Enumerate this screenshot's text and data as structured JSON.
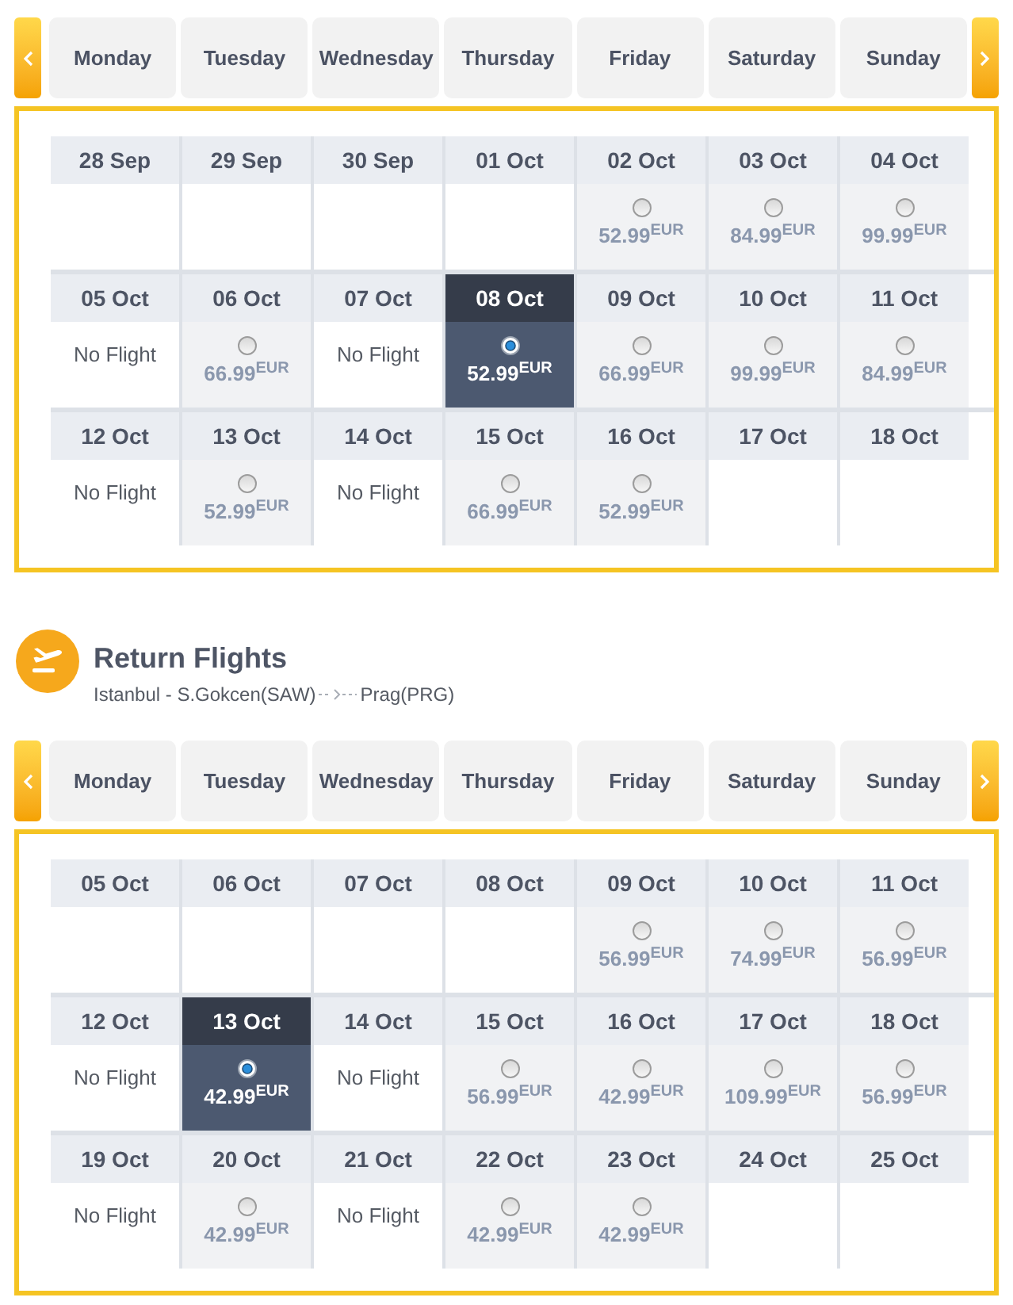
{
  "outbound_calendar": {
    "weekdays": [
      "Monday",
      "Tuesday",
      "Wednesday",
      "Thursday",
      "Friday",
      "Saturday",
      "Sunday"
    ],
    "weeks": [
      [
        {
          "date": "28 Sep",
          "kind": "empty"
        },
        {
          "date": "29 Sep",
          "kind": "empty"
        },
        {
          "date": "30 Sep",
          "kind": "empty"
        },
        {
          "date": "01 Oct",
          "kind": "empty"
        },
        {
          "date": "02 Oct",
          "kind": "fare",
          "price": "52.99",
          "currency": "EUR",
          "selected": false
        },
        {
          "date": "03 Oct",
          "kind": "fare",
          "price": "84.99",
          "currency": "EUR",
          "selected": false
        },
        {
          "date": "04 Oct",
          "kind": "fare",
          "price": "99.99",
          "currency": "EUR",
          "selected": false
        }
      ],
      [
        {
          "date": "05 Oct",
          "kind": "no_flight",
          "text": "No Flight"
        },
        {
          "date": "06 Oct",
          "kind": "fare",
          "price": "66.99",
          "currency": "EUR",
          "selected": false
        },
        {
          "date": "07 Oct",
          "kind": "no_flight",
          "text": "No Flight"
        },
        {
          "date": "08 Oct",
          "kind": "fare",
          "price": "52.99",
          "currency": "EUR",
          "selected": true
        },
        {
          "date": "09 Oct",
          "kind": "fare",
          "price": "66.99",
          "currency": "EUR",
          "selected": false
        },
        {
          "date": "10 Oct",
          "kind": "fare",
          "price": "99.99",
          "currency": "EUR",
          "selected": false
        },
        {
          "date": "11 Oct",
          "kind": "fare",
          "price": "84.99",
          "currency": "EUR",
          "selected": false
        }
      ],
      [
        {
          "date": "12 Oct",
          "kind": "no_flight",
          "text": "No Flight"
        },
        {
          "date": "13 Oct",
          "kind": "fare",
          "price": "52.99",
          "currency": "EUR",
          "selected": false
        },
        {
          "date": "14 Oct",
          "kind": "no_flight",
          "text": "No Flight"
        },
        {
          "date": "15 Oct",
          "kind": "fare",
          "price": "66.99",
          "currency": "EUR",
          "selected": false
        },
        {
          "date": "16 Oct",
          "kind": "fare",
          "price": "52.99",
          "currency": "EUR",
          "selected": false
        },
        {
          "date": "17 Oct",
          "kind": "empty"
        },
        {
          "date": "18 Oct",
          "kind": "empty"
        }
      ]
    ]
  },
  "return_flights": {
    "title": "Return Flights",
    "route": {
      "origin": "Istanbul - S.Gokcen(SAW)",
      "destination": "Prag(PRG)"
    },
    "calendar": {
      "weekdays": [
        "Monday",
        "Tuesday",
        "Wednesday",
        "Thursday",
        "Friday",
        "Saturday",
        "Sunday"
      ],
      "weeks": [
        [
          {
            "date": "05 Oct",
            "kind": "empty"
          },
          {
            "date": "06 Oct",
            "kind": "empty"
          },
          {
            "date": "07 Oct",
            "kind": "empty"
          },
          {
            "date": "08 Oct",
            "kind": "empty"
          },
          {
            "date": "09 Oct",
            "kind": "fare",
            "price": "56.99",
            "currency": "EUR",
            "selected": false
          },
          {
            "date": "10 Oct",
            "kind": "fare",
            "price": "74.99",
            "currency": "EUR",
            "selected": false
          },
          {
            "date": "11 Oct",
            "kind": "fare",
            "price": "56.99",
            "currency": "EUR",
            "selected": false
          }
        ],
        [
          {
            "date": "12 Oct",
            "kind": "no_flight",
            "text": "No Flight"
          },
          {
            "date": "13 Oct",
            "kind": "fare",
            "price": "42.99",
            "currency": "EUR",
            "selected": true
          },
          {
            "date": "14 Oct",
            "kind": "no_flight",
            "text": "No Flight"
          },
          {
            "date": "15 Oct",
            "kind": "fare",
            "price": "56.99",
            "currency": "EUR",
            "selected": false
          },
          {
            "date": "16 Oct",
            "kind": "fare",
            "price": "42.99",
            "currency": "EUR",
            "selected": false
          },
          {
            "date": "17 Oct",
            "kind": "fare",
            "price": "109.99",
            "currency": "EUR",
            "selected": false
          },
          {
            "date": "18 Oct",
            "kind": "fare",
            "price": "56.99",
            "currency": "EUR",
            "selected": false
          }
        ],
        [
          {
            "date": "19 Oct",
            "kind": "no_flight",
            "text": "No Flight"
          },
          {
            "date": "20 Oct",
            "kind": "fare",
            "price": "42.99",
            "currency": "EUR",
            "selected": false
          },
          {
            "date": "21 Oct",
            "kind": "no_flight",
            "text": "No Flight"
          },
          {
            "date": "22 Oct",
            "kind": "fare",
            "price": "42.99",
            "currency": "EUR",
            "selected": false
          },
          {
            "date": "23 Oct",
            "kind": "fare",
            "price": "42.99",
            "currency": "EUR",
            "selected": false
          },
          {
            "date": "24 Oct",
            "kind": "empty"
          },
          {
            "date": "25 Oct",
            "kind": "empty"
          }
        ]
      ]
    }
  }
}
